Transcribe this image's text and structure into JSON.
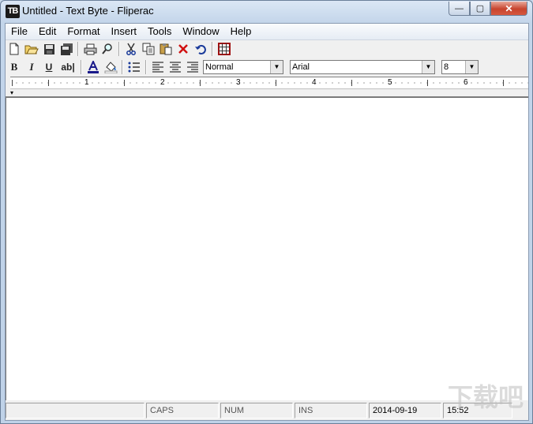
{
  "window": {
    "title": "Untitled - Text Byte - Fliperac",
    "app_icon_text": "TB",
    "minimize_glyph": "—",
    "maximize_glyph": "▢",
    "close_glyph": "✕"
  },
  "menu": {
    "items": [
      "File",
      "Edit",
      "Format",
      "Insert",
      "Tools",
      "Window",
      "Help"
    ]
  },
  "toolbar1": {
    "buttons": [
      "new-file-icon",
      "open-folder-icon",
      "save-icon",
      "save-all-icon",
      "print-icon",
      "print-preview-icon",
      "cut-icon",
      "copy-icon",
      "paste-icon",
      "delete-icon",
      "undo-icon",
      "grid-icon"
    ]
  },
  "toolbar2": {
    "bold": "B",
    "italic": "I",
    "underline": "U",
    "strike": "ab|",
    "style_value": "Normal",
    "font_value": "Arial",
    "size_value": "8"
  },
  "ruler": {
    "numbers": [
      "1",
      "2",
      "3",
      "4",
      "5",
      "6"
    ]
  },
  "status": {
    "pane1": "",
    "caps": "CAPS",
    "num": "NUM",
    "ins": "INS",
    "date": "2014-09-19",
    "time": "15:52"
  },
  "watermark": "下载吧"
}
